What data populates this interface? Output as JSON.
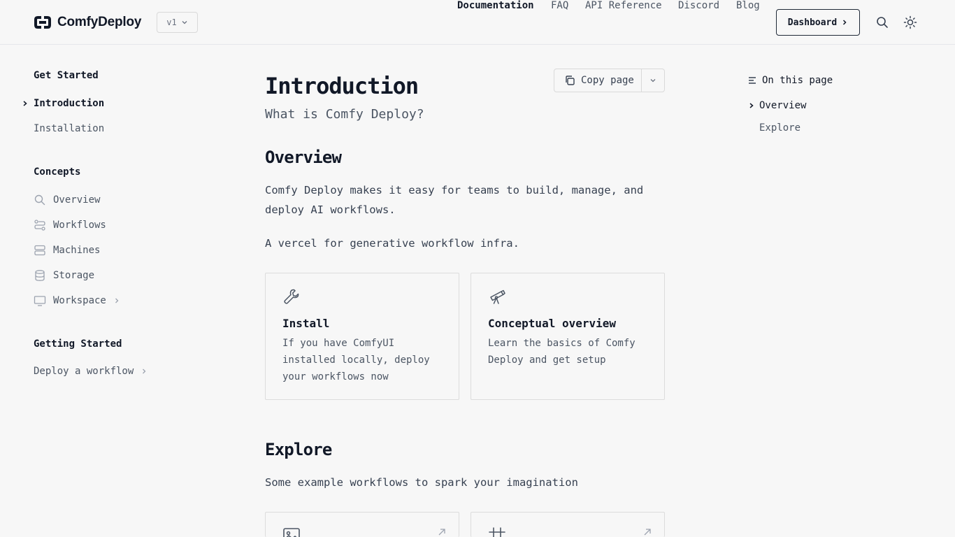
{
  "header": {
    "brand": "ComfyDeploy",
    "version": "v1",
    "nav": [
      {
        "label": "Documentation",
        "active": true
      },
      {
        "label": "FAQ",
        "active": false
      },
      {
        "label": "API Reference",
        "active": false
      },
      {
        "label": "Discord",
        "active": false
      },
      {
        "label": "Blog",
        "active": false
      }
    ],
    "dashboard_label": "Dashboard",
    "icons": [
      "search-icon",
      "sun-icon"
    ]
  },
  "sidebar": {
    "sections": [
      {
        "heading": "Get Started",
        "items": [
          {
            "label": "Introduction",
            "active": true
          },
          {
            "label": "Installation",
            "active": false
          }
        ]
      },
      {
        "heading": "Concepts",
        "items": [
          {
            "label": "Overview",
            "icon": "search-icon"
          },
          {
            "label": "Workflows",
            "icon": "workflow-icon"
          },
          {
            "label": "Machines",
            "icon": "server-icon"
          },
          {
            "label": "Storage",
            "icon": "database-icon"
          },
          {
            "label": "Workspace",
            "icon": "monitor-icon",
            "expandable": true
          }
        ]
      },
      {
        "heading": "Getting Started",
        "items": [
          {
            "label": "Deploy a workflow",
            "expandable": true
          }
        ]
      }
    ]
  },
  "main": {
    "title": "Introduction",
    "subtitle": "What is Comfy Deploy?",
    "copy_label": "Copy page",
    "overview": {
      "heading": "Overview",
      "para1": "Comfy Deploy makes it easy for teams to build, manage, and deploy AI workflows.",
      "para2": "A vercel for generative workflow infra."
    },
    "cards": [
      {
        "title": "Install",
        "desc": "If you have ComfyUI installed locally, deploy your workflows now",
        "icon": "wrench-icon"
      },
      {
        "title": "Conceptual overview",
        "desc": "Learn the basics of Comfy Deploy and get setup",
        "icon": "telescope-icon"
      }
    ],
    "explore": {
      "heading": "Explore",
      "para": "Some example workflows to spark your imagination",
      "cards": [
        {
          "icon": "image-icon"
        },
        {
          "icon": "frame-icon"
        }
      ]
    }
  },
  "toc": {
    "title": "On this page",
    "items": [
      {
        "label": "Overview",
        "active": true
      },
      {
        "label": "Explore",
        "active": false
      }
    ]
  },
  "colors": {
    "text": "#111827",
    "muted": "#4b5563",
    "border": "#dcdcdc",
    "background": "#f7f7f7"
  }
}
